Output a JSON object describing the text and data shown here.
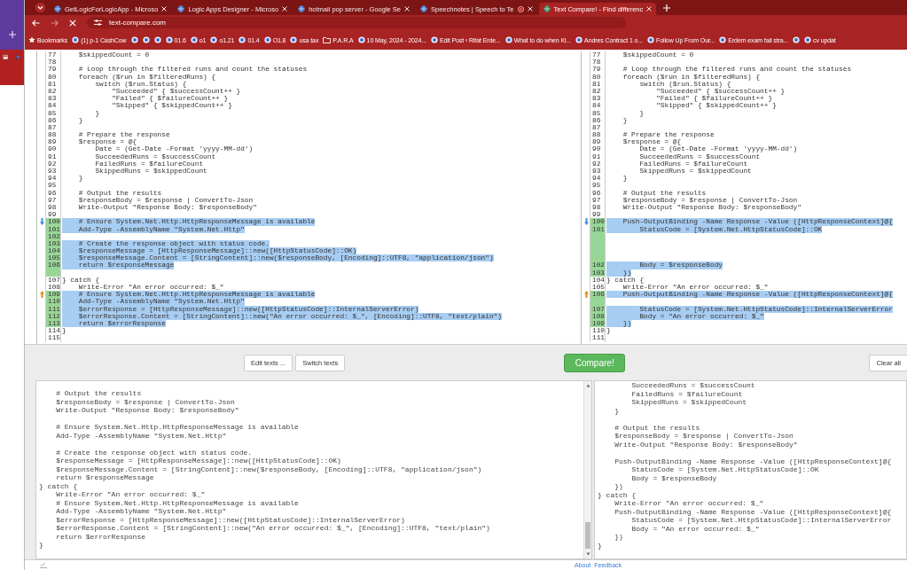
{
  "browser": {
    "tabs": [
      {
        "label": "GetLogicForLogicApp - Microso",
        "selected": false,
        "recording": false
      },
      {
        "label": "Logic Apps Designer - Microso",
        "selected": false,
        "recording": false
      },
      {
        "label": "hotmail pop server - Google Se",
        "selected": false,
        "recording": false
      },
      {
        "label": "Speechnotes | Speech to Te",
        "selected": false,
        "recording": true
      },
      {
        "label": "Text Compare! - Find differenc",
        "selected": true,
        "recording": false
      }
    ],
    "address": "text-compare.com",
    "bookmarks": [
      {
        "kind": "all",
        "label": "Bookmarks"
      },
      {
        "kind": "site",
        "label": "(1) p-1 CashCow"
      },
      {
        "kind": "site"
      },
      {
        "kind": "site"
      },
      {
        "kind": "site"
      },
      {
        "kind": "site",
        "label": "01.6"
      },
      {
        "kind": "site",
        "label": "o1"
      },
      {
        "kind": "site",
        "label": "o1.21"
      },
      {
        "kind": "site",
        "label": "01.4"
      },
      {
        "kind": "site",
        "label": "O1.8"
      },
      {
        "kind": "site",
        "label": "usa tax"
      },
      {
        "kind": "folder",
        "label": "P.A.R.A"
      },
      {
        "kind": "site",
        "label": "10 May, 2024 - 2024..."
      },
      {
        "kind": "site",
        "label": "Edit Post ‹ Rifat Erde..."
      },
      {
        "kind": "site",
        "label": "What to do when Ki..."
      },
      {
        "kind": "site",
        "label": "Andres Contract 1 o..."
      },
      {
        "kind": "site",
        "label": "Follow Up From Our..."
      },
      {
        "kind": "site",
        "label": "Erdem exam fail stra..."
      },
      {
        "kind": "site"
      },
      {
        "kind": "site",
        "label": "cv updat"
      }
    ]
  },
  "diff": {
    "left": [
      {
        "kind": "line",
        "n": "77",
        "text": "    $skippedCount = 0",
        "changed": false
      },
      {
        "kind": "line",
        "n": "78",
        "changed": false
      },
      {
        "kind": "line",
        "n": "79",
        "text": "    # Loop through the filtered runs and count the statuses",
        "changed": false
      },
      {
        "kind": "line",
        "n": "80",
        "text": "    foreach ($run in $filteredRuns) {",
        "changed": false
      },
      {
        "kind": "line",
        "n": "81",
        "text": "        switch ($run.Status) {",
        "changed": false
      },
      {
        "kind": "line",
        "n": "82",
        "text": "            \"Succeeded\" { $successCount++ }",
        "changed": false
      },
      {
        "kind": "line",
        "n": "83",
        "text": "            \"Failed\" { $failureCount++ }",
        "changed": false
      },
      {
        "kind": "line",
        "n": "84",
        "text": "            \"Skipped\" { $skippedCount++ }",
        "changed": false
      },
      {
        "kind": "line",
        "n": "85",
        "text": "        }",
        "changed": false
      },
      {
        "kind": "line",
        "n": "86",
        "text": "    }",
        "changed": false
      },
      {
        "kind": "line",
        "n": "87",
        "changed": false
      },
      {
        "kind": "line",
        "n": "88",
        "text": "    # Prepare the response",
        "changed": false
      },
      {
        "kind": "line",
        "n": "89",
        "text": "    $response = @{",
        "changed": false
      },
      {
        "kind": "line",
        "n": "90",
        "text": "        Date = (Get-Date -Format 'yyyy-MM-dd')",
        "changed": false
      },
      {
        "kind": "line",
        "n": "91",
        "text": "        SucceededRuns = $successCount",
        "changed": false
      },
      {
        "kind": "line",
        "n": "92",
        "text": "        FailedRuns = $failureCount",
        "changed": false
      },
      {
        "kind": "line",
        "n": "93",
        "text": "        SkippedRuns = $skippedCount",
        "changed": false
      },
      {
        "kind": "line",
        "n": "94",
        "text": "    }",
        "changed": false
      },
      {
        "kind": "line",
        "n": "95",
        "changed": false
      },
      {
        "kind": "line",
        "n": "96",
        "text": "    # Output the results",
        "changed": false
      },
      {
        "kind": "line",
        "n": "97",
        "text": "    $responseBody = $response | ConvertTo-Json",
        "changed": false
      },
      {
        "kind": "line",
        "n": "98",
        "text": "    Write-Output \"Response Body: $responseBody\"",
        "changed": false
      },
      {
        "kind": "line",
        "n": "99",
        "changed": false
      },
      {
        "kind": "next-diff",
        "n": "100",
        "text": "    # Ensure System.Net.Http.HttpResponseMessage is available",
        "changed": true
      },
      {
        "kind": "line",
        "n": "101",
        "text": "    Add-Type -AssemblyName \"System.Net.Http\"",
        "changed": true
      },
      {
        "kind": "line",
        "n": "102",
        "changed": true
      },
      {
        "kind": "line",
        "n": "103",
        "text": "    # Create the response object with status code.",
        "changed": true
      },
      {
        "kind": "line",
        "n": "104",
        "text": "    $responseMessage = [HttpResponseMessage]::new([HttpStatusCode]::OK)",
        "changed": true
      },
      {
        "kind": "line",
        "n": "105",
        "text": "    $responseMessage.Content = [StringContent]::new($responseBody, [Encoding]::UTF8, \"application/json\")",
        "changed": true
      },
      {
        "kind": "line",
        "n": "106",
        "text": "    return $responseMessage",
        "changed": true
      },
      {
        "kind": "gap",
        "changed": true
      },
      {
        "kind": "line",
        "n": "107",
        "text": "} catch {",
        "changed": false
      },
      {
        "kind": "line",
        "n": "108",
        "text": "    Write-Error \"An error occurred: $_\"",
        "changed": false
      },
      {
        "kind": "prev-diff",
        "n": "109",
        "text": "    # Ensure System.Net.Http.HttpResponseMessage is available",
        "changed": true
      },
      {
        "kind": "line",
        "n": "110",
        "text": "    Add-Type -AssemblyName \"System.Net.Http\"",
        "changed": true
      },
      {
        "kind": "line",
        "n": "111",
        "text": "    $errorResponse = [HttpResponseMessage]::new([HttpStatusCode]::InternalServerError)",
        "changed": true
      },
      {
        "kind": "line",
        "n": "112",
        "text": "    $errorResponse.Content = [StringContent]::new(\"An error occurred: $_\", [Encoding]::UTF8, \"text/plain\")",
        "changed": true
      },
      {
        "kind": "line",
        "n": "113",
        "text": "    return $errorResponse",
        "changed": true
      },
      {
        "kind": "line",
        "n": "114",
        "text": "}",
        "changed": false
      },
      {
        "kind": "line",
        "n": "115",
        "changed": false
      }
    ],
    "right": [
      {
        "kind": "line",
        "n": "77",
        "text": "    $skippedCount = 0",
        "changed": false
      },
      {
        "kind": "line",
        "n": "78",
        "changed": false
      },
      {
        "kind": "line",
        "n": "79",
        "text": "    # Loop through the filtered runs and count the statuses",
        "changed": false
      },
      {
        "kind": "line",
        "n": "80",
        "text": "    foreach ($run in $filteredRuns) {",
        "changed": false
      },
      {
        "kind": "line",
        "n": "81",
        "text": "        switch ($run.Status) {",
        "changed": false
      },
      {
        "kind": "line",
        "n": "82",
        "text": "            \"Succeeded\" { $successCount++ }",
        "changed": false
      },
      {
        "kind": "line",
        "n": "83",
        "text": "            \"Failed\" { $failureCount++ }",
        "changed": false
      },
      {
        "kind": "line",
        "n": "84",
        "text": "            \"Skipped\" { $skippedCount++ }",
        "changed": false
      },
      {
        "kind": "line",
        "n": "85",
        "text": "        }",
        "changed": false
      },
      {
        "kind": "line",
        "n": "86",
        "text": "    }",
        "changed": false
      },
      {
        "kind": "line",
        "n": "87",
        "changed": false
      },
      {
        "kind": "line",
        "n": "88",
        "text": "    # Prepare the response",
        "changed": false
      },
      {
        "kind": "line",
        "n": "89",
        "text": "    $response = @{",
        "changed": false
      },
      {
        "kind": "line",
        "n": "90",
        "text": "        Date = (Get-Date -Format 'yyyy-MM-dd')",
        "changed": false
      },
      {
        "kind": "line",
        "n": "91",
        "text": "        SucceededRuns = $successCount",
        "changed": false
      },
      {
        "kind": "line",
        "n": "92",
        "text": "        FailedRuns = $failureCount",
        "changed": false
      },
      {
        "kind": "line",
        "n": "93",
        "text": "        SkippedRuns = $skippedCount",
        "changed": false
      },
      {
        "kind": "line",
        "n": "94",
        "text": "    }",
        "changed": false
      },
      {
        "kind": "line",
        "n": "95",
        "changed": false
      },
      {
        "kind": "line",
        "n": "96",
        "text": "    # Output the results",
        "changed": false
      },
      {
        "kind": "line",
        "n": "97",
        "text": "    $responseBody = $response | ConvertTo-Json",
        "changed": false
      },
      {
        "kind": "line",
        "n": "98",
        "text": "    Write-Output \"Response Body: $responseBody\"",
        "changed": false
      },
      {
        "kind": "line",
        "n": "99",
        "changed": false
      },
      {
        "kind": "next-diff",
        "n": "100",
        "text": "    Push-OutputBinding -Name Response -Value ([HttpResponseContext]@{",
        "changed": true
      },
      {
        "kind": "line",
        "n": "101",
        "text": "        StatusCode = [System.Net.HttpStatusCode]::OK",
        "changed": true
      },
      {
        "kind": "gap",
        "changed": true
      },
      {
        "kind": "gap",
        "changed": true
      },
      {
        "kind": "gap",
        "changed": true
      },
      {
        "kind": "gap",
        "changed": true
      },
      {
        "kind": "line",
        "n": "102",
        "text": "        Body = $responseBody",
        "changed": true
      },
      {
        "kind": "line",
        "n": "103",
        "text": "    })",
        "changed": true
      },
      {
        "kind": "line",
        "n": "104",
        "text": "} catch {",
        "changed": false
      },
      {
        "kind": "line",
        "n": "105",
        "text": "    Write-Error \"An error occurred: $_\"",
        "changed": false
      },
      {
        "kind": "prev-diff",
        "n": "106",
        "text": "    Push-OutputBinding -Name Response -Value ([HttpResponseContext]@{",
        "changed": true
      },
      {
        "kind": "gap",
        "changed": true
      },
      {
        "kind": "line",
        "n": "107",
        "text": "        StatusCode = [System.Net.HttpStatusCode]::InternalServerError",
        "changed": true
      },
      {
        "kind": "line",
        "n": "108",
        "text": "        Body = \"An error occurred: $_\"",
        "changed": true
      },
      {
        "kind": "line",
        "n": "109",
        "text": "    })",
        "changed": true
      },
      {
        "kind": "line",
        "n": "110",
        "text": "}",
        "changed": false
      },
      {
        "kind": "line",
        "n": "111",
        "changed": false
      }
    ]
  },
  "buttons": [
    {
      "label": "Edit texts ...",
      "kind": "plain"
    },
    {
      "label": "Switch texts",
      "kind": "plain"
    },
    {
      "label": "Compare!",
      "kind": "primary"
    },
    {
      "label": "Clear all",
      "kind": "plain"
    }
  ],
  "editors": [
    {
      "text": "    # Output the results\n    $responseBody = $response | ConvertTo-Json\n    Write-Output \"Response Body: $responseBody\"\n\n    # Ensure System.Net.Http.HttpResponseMessage is available\n    Add-Type -AssemblyName \"System.Net.Http\"\n\n    # Create the response object with status code.\n    $responseMessage = [HttpResponseMessage]::new([HttpStatusCode]::OK)\n    $responseMessage.Content = [StringContent]::new($responseBody, [Encoding]::UTF8, \"application/json\")\n    return $responseMessage\n} catch {\n    Write-Error \"An error occurred: $_\"\n    # Ensure System.Net.Http.HttpResponseMessage is available\n    Add-Type -AssemblyName \"System.Net.Http\"\n    $errorResponse = [HttpResponseMessage]::new([HttpStatusCode]::InternalServerError)\n    $errorResponse.Content = [StringContent]::new(\"An error occurred: $_\", [Encoding]::UTF8, \"text/plain\")\n    return $errorResponse\n}"
    },
    {
      "text": "        SucceededRuns = $successCount\n        FailedRuns = $failureCount\n        SkippedRuns = $skippedCount\n    }\n\n    # Output the results\n    $responseBody = $response | ConvertTo-Json\n    Write-Output \"Response Body: $responseBody\"\n\n    Push-OutputBinding -Name Response -Value ([HttpResponseContext]@{\n        StatusCode = [System.Net.HttpStatusCode]::OK\n        Body = $responseBody\n    })\n} catch {\n    Write-Error \"An error occurred: $_\"\n    Push-OutputBinding -Name Response -Value ([HttpResponseContext]@{\n        StatusCode = [System.Net.HttpStatusCode]::InternalServerError\n        Body = \"An error occurred: $_\"\n    })\n}"
    }
  ],
  "footer_links": [
    "About",
    "Feedback"
  ]
}
